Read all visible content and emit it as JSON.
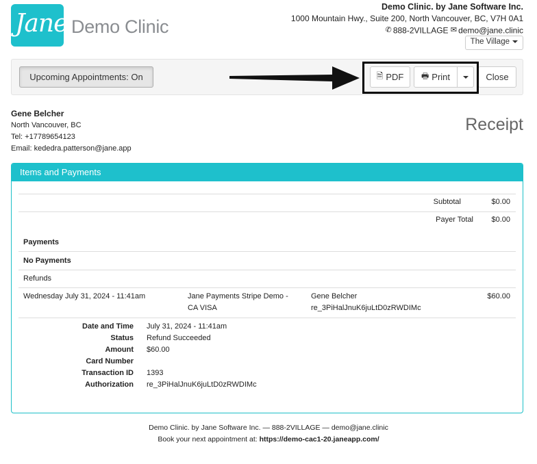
{
  "logo": {
    "text": "Jane",
    "clinic": "Demo Clinic"
  },
  "header": {
    "org": "Demo Clinic. by Jane Software Inc.",
    "address": "1000 Mountain Hwy., Suite 200, North Vancouver, BC, V7H 0A1",
    "phone": "888-2VILLAGE",
    "email": "demo@jane.clinic",
    "location": "The Village"
  },
  "toolbar": {
    "upcoming_label": "Upcoming Appointments: On",
    "pdf_label": "PDF",
    "print_label": "Print",
    "close_label": "Close"
  },
  "patient": {
    "name": "Gene Belcher",
    "city": "North Vancouver, BC",
    "tel": "Tel: +17789654123",
    "email": "Email: kededra.patterson@jane.app"
  },
  "receipt_title": "Receipt",
  "panel": {
    "title": "Items and Payments",
    "subtotal_label": "Subtotal",
    "subtotal_value": "$0.00",
    "payer_total_label": "Payer Total",
    "payer_total_value": "$0.00",
    "payments_label": "Payments",
    "no_payments": "No Payments",
    "refunds_label": "Refunds",
    "refund": {
      "date": "Wednesday July 31, 2024 - 11:41am",
      "method_line1": "Jane Payments Stripe Demo -",
      "method_line2": "CA VISA",
      "payer": "Gene Belcher",
      "ref": "re_3PiHalJnuK6juLtD0zRWDIMc",
      "amount": "$60.00"
    },
    "details": {
      "date_label": "Date and Time",
      "date_value": "July 31, 2024 - 11:41am",
      "status_label": "Status",
      "status_value": "Refund Succeeded",
      "amount_label": "Amount",
      "amount_value": "$60.00",
      "card_label": "Card Number",
      "card_value": "",
      "txn_label": "Transaction ID",
      "txn_value": "1393",
      "auth_label": "Authorization",
      "auth_value": "re_3PiHalJnuK6juLtD0zRWDIMc"
    }
  },
  "footer": {
    "line1": "Demo Clinic. by Jane Software Inc. — 888-2VILLAGE — demo@jane.clinic",
    "line2_prefix": "Book your next appointment at: ",
    "line2_url": "https://demo-cac1-20.janeapp.com/"
  },
  "colors": {
    "accent": "#1ec0cc",
    "logo_gray": "#8a8d91"
  }
}
